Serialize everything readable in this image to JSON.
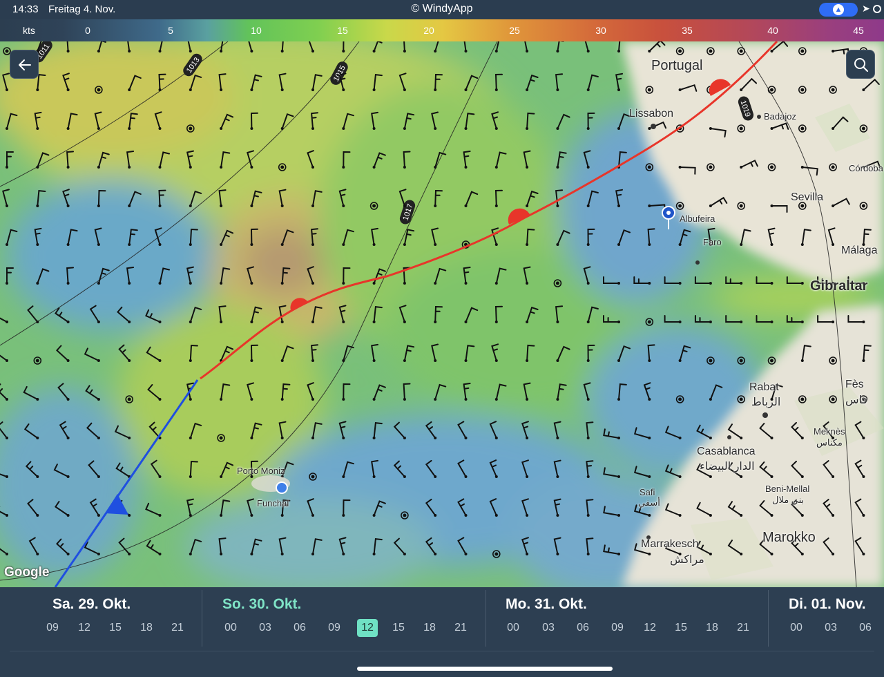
{
  "status": {
    "time": "14:33",
    "date": "Freitag 4. Nov.",
    "center": "© WindyApp",
    "nav_icon": "navigation-arrow-icon",
    "location_icon": "location-arrow-icon"
  },
  "legend": {
    "unit": "kts",
    "values": [
      "0",
      "5",
      "10",
      "15",
      "20",
      "25",
      "30",
      "35",
      "40",
      "45"
    ]
  },
  "map": {
    "back_icon": "back-arrow-icon",
    "search_icon": "search-icon",
    "attribution": "Google",
    "isobars": [
      "1011",
      "1013",
      "1015",
      "1017",
      "1019"
    ],
    "places": {
      "portugal": "Portugal",
      "lissabon": "Lissabon",
      "badajoz": "Badajoz",
      "cordoba": "Córdoba",
      "sevilla": "Sevilla",
      "albufeira": "Albufeira",
      "faro": "Faro",
      "malaga": "Málaga",
      "gibraltar": "Gibraltar",
      "rabat": "Rabat",
      "rabat_ar": "الرباط",
      "fes": "Fès",
      "fes_ar": "فاس",
      "meknes": "Meknès",
      "meknes_ar": "مكناس",
      "casablanca": "Casablanca",
      "casablanca_ar": "الدار البيضاء",
      "beni_mellal": "Beni-Mellal",
      "beni_mellal_ar": "بني ملال",
      "safi": "Safi",
      "safi_ar": "أسفي",
      "marrakesch": "Marrakesch",
      "marrakesch_ar": "مراكش",
      "marokko": "Marokko",
      "porto_moniz": "Porto Moniz",
      "funchal": "Funchal"
    }
  },
  "timeline": {
    "days": [
      {
        "label": "Sa. 29. Okt.",
        "hours": [
          "09",
          "12",
          "15",
          "18",
          "21"
        ]
      },
      {
        "label": "So. 30. Okt.",
        "hours": [
          "00",
          "03",
          "06",
          "09",
          "12",
          "15",
          "18",
          "21"
        ],
        "active": true
      },
      {
        "label": "Mo. 31. Okt.",
        "hours": [
          "00",
          "03",
          "06",
          "09",
          "12",
          "15",
          "18",
          "21"
        ]
      },
      {
        "label": "Di. 01. Nov.",
        "hours": [
          "00",
          "03",
          "06"
        ]
      }
    ],
    "selected": "12"
  },
  "colors": {
    "warm_front": "#e8352a",
    "cold_front": "#1f4fe0",
    "accent": "#6fe1c4"
  }
}
